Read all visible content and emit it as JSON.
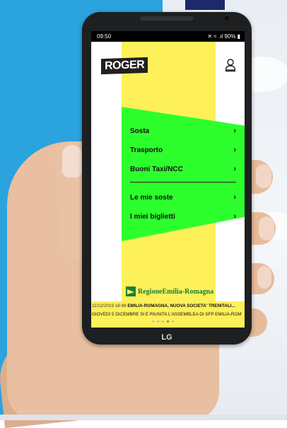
{
  "status_bar": {
    "time": "09:50",
    "indicators": "✕ ≈ .ıl 90% ▮"
  },
  "app": {
    "brand": "ROGER",
    "profile_icon": "person-outline-icon"
  },
  "menu": {
    "primary": [
      {
        "label": "Sosta"
      },
      {
        "label": "Trasporto"
      },
      {
        "label": "Buoni Taxi/NCC"
      }
    ],
    "secondary": [
      {
        "label": "Le mie soste"
      },
      {
        "label": "I miei biglietti"
      }
    ],
    "chevron": "›"
  },
  "footer": {
    "region_logo_text": "RegioneEmilia-Romagna",
    "news_timestamp": "11/12/2019 16:48",
    "news_headline": "EMILIA-ROMAGNA, NUOVA SOCIETA' TRENITALI...",
    "news_body": "GIOVEDÌ 5 DICEMBRE SI È RIUNITA L'ASSEMBLEA DI SFP EMILIA-ROM",
    "carousel_pages": 5,
    "carousel_active": 4
  },
  "device": {
    "maker_logo": "LG"
  },
  "colors": {
    "background_blue": "#2aa3df",
    "accent_yellow": "#fdf059",
    "accent_green": "#2dff2d",
    "region_green": "#16803a",
    "brand_dark": "#231f20"
  }
}
